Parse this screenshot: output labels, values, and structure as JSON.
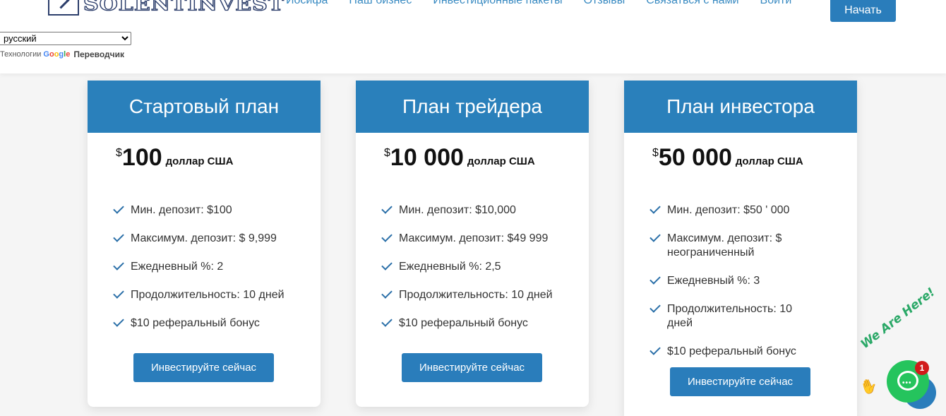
{
  "header": {
    "logo_text": "SOLENTINVEST",
    "nav": [
      "Иосифа",
      "Наш бизнес",
      "Инвестиционные пакеты",
      "Отзывы",
      "Связаться с нами",
      "Войти"
    ],
    "start_button": "Начать"
  },
  "translate": {
    "selected_language": "русский",
    "tech_label": "Технологии",
    "google": "Google",
    "translator": "Переводчик"
  },
  "plans": [
    {
      "title": "Стартовый план",
      "currency": "$",
      "amount": "100",
      "unit": "доллар США",
      "features": [
        "Мин. депозит: $100",
        "Максимум. депозит: $ 9,999",
        "Ежедневный %: 2",
        "Продолжительность: 10 дней",
        "$10 реферальный бонус"
      ],
      "button": "Инвестируйте сейчас"
    },
    {
      "title": "План трейдера",
      "currency": "$",
      "amount": "10 000",
      "unit": "доллар США",
      "features": [
        "Мин. депозит: $10,000",
        "Максимум. депозит: $49 999",
        "Ежедневный %: 2,5",
        "Продолжительность: 10 дней",
        "$10 реферальный бонус"
      ],
      "button": "Инвестируйте сейчас"
    },
    {
      "title": "План инвестора",
      "currency": "$",
      "amount": "50 000",
      "unit": "доллар США",
      "features": [
        "Мин. депозит: $50 ' 000",
        "Максимум. депозит: $ неограниченный",
        "Ежедневный %: 3",
        "Продолжительность: 10 дней",
        "$10 реферальный бонус"
      ],
      "button": "Инвестируйте сейчас"
    }
  ],
  "chat_widget": {
    "tagline": "We Are Here!",
    "badge_count": "1"
  },
  "colors": {
    "primary": "#2a80bb",
    "button": "#2a7dbb",
    "chat_green": "#25c45d",
    "badge_red": "#d11a1a",
    "check": "#2a6fa8"
  }
}
